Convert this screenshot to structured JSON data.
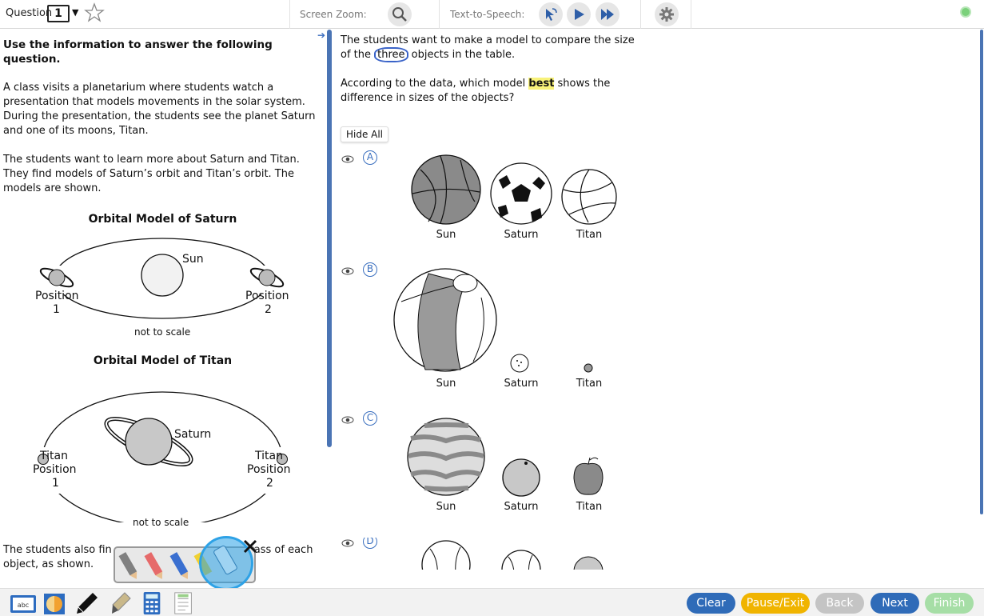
{
  "topbar": {
    "question_label": "Question",
    "question_number": "1",
    "dropdown_arrow": "▼",
    "screen_zoom_label": "Screen Zoom:",
    "tts_label": "Text-to-Speech:",
    "icons": [
      "star-icon",
      "magnifier-icon",
      "tts-select-icon",
      "play-icon",
      "fast-forward-icon",
      "gear-icon",
      "status-dot-icon"
    ]
  },
  "passage": {
    "instruction": "Use the information to answer the following question.",
    "para1": "A class visits a planetarium where students watch a presentation that models movements in the solar system. During the presentation, the students see the planet Saturn and one of its moons, Titan.",
    "para2": "The students want to learn more about Saturn and Titan. They find models of Saturn’s orbit and Titan’s orbit. The models are shown.",
    "saturn_model": {
      "title": "Orbital Model of Saturn",
      "center_label": "Sun",
      "pos1_label": "Position",
      "pos1_num": "1",
      "pos2_label": "Position",
      "pos2_num": "2",
      "note": "not to scale"
    },
    "titan_model": {
      "title": "Orbital Model of Titan",
      "center_label": "Saturn",
      "pos1_label_a": "Titan",
      "pos1_label_b": "Position",
      "pos1_num": "1",
      "pos2_label_a": "Titan",
      "pos2_label_b": "Position",
      "pos2_num": "2",
      "note": "not to scale"
    },
    "tail_left": "The students also fin",
    "tail_right": "ass of each",
    "tail_line2": "object, as shown."
  },
  "question": {
    "line1_pre": "The students want to make a model to compare the size of the ",
    "line1_circled": "three",
    "line1_post": " objects in the table.",
    "line2_pre": "According to the data, which model ",
    "line2_highlight": "best",
    "line2_post": " shows the difference in sizes of the objects?",
    "hide_all": "Hide All"
  },
  "options": [
    {
      "letter": "A",
      "labels": [
        "Sun",
        "Saturn",
        "Titan"
      ]
    },
    {
      "letter": "B",
      "labels": [
        "Sun",
        "Saturn",
        "Titan"
      ]
    },
    {
      "letter": "C",
      "labels": [
        "Sun",
        "Saturn",
        "Titan"
      ]
    },
    {
      "letter": "D",
      "labels": []
    }
  ],
  "bottombar": {
    "tools": [
      "dictionary-icon",
      "contrast-icon",
      "pen-icon",
      "highlighter-icon",
      "calculator-icon",
      "notepad-icon"
    ],
    "buttons": {
      "clear": "Clear",
      "pause_exit": "Pause/Exit",
      "back": "Back",
      "next": "Next",
      "finish": "Finish"
    }
  },
  "colors": {
    "accent_blue": "#3a6fbf",
    "pause_yellow": "#f0b400",
    "disabled_gray": "#c4c4c4",
    "finish_green": "#a6dea6",
    "highlight": "#f8f27a"
  }
}
